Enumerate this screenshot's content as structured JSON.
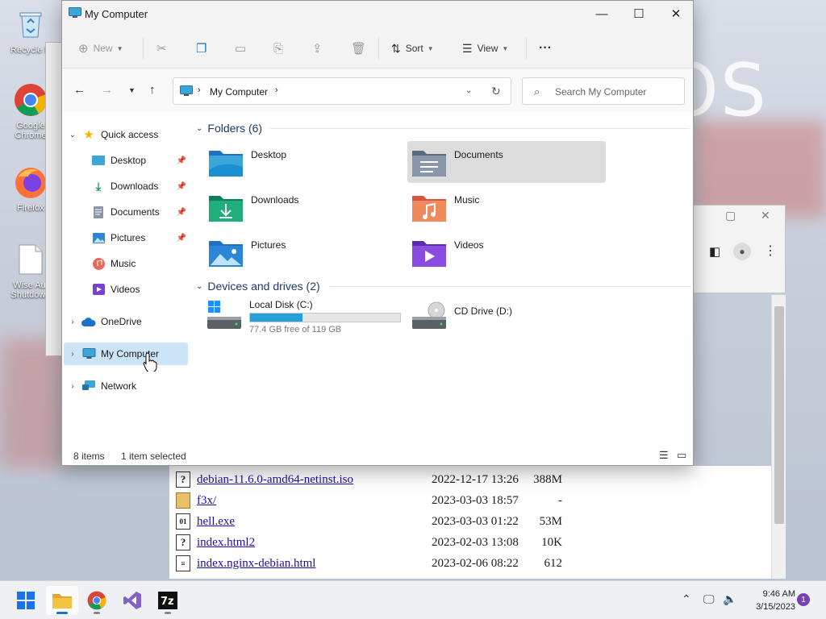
{
  "desktop": {
    "bg_text": "OS",
    "icons": [
      {
        "label": "Recycle Bin",
        "display": "Recycle B"
      },
      {
        "label": "Google Chrome",
        "display": "Google Chrome"
      },
      {
        "label": "Firefox",
        "display": "Firefox"
      },
      {
        "label": "Wise Auto Shutdown",
        "display": "Wise Aut Shutdown"
      }
    ]
  },
  "listing": {
    "rows": [
      {
        "icon": "?",
        "name": "debian-11.6.0-amd64-netinst.iso",
        "date": "2022-12-17 13:26",
        "size": "388M"
      },
      {
        "icon": "folder",
        "name": "f3x/",
        "date": "2023-03-03 18:57",
        "size": "-"
      },
      {
        "icon": "bin",
        "name": "hell.exe",
        "date": "2023-03-03 01:22",
        "size": "53M"
      },
      {
        "icon": "?",
        "name": "index.html2",
        "date": "2023-02-03 13:08",
        "size": "10K"
      },
      {
        "icon": "doc",
        "name": "index.nginx-debian.html",
        "date": "2023-02-06 08:22",
        "size": "612"
      }
    ]
  },
  "explorer": {
    "title": "My Computer",
    "toolbar": {
      "new_label": "New",
      "sort_label": "Sort",
      "view_label": "View",
      "more_label": "···"
    },
    "address": {
      "path": "My Computer",
      "search_placeholder": "Search My Computer"
    },
    "sidebar": {
      "quick_access": "Quick access",
      "pinned": [
        {
          "label": "Desktop",
          "pinned": true
        },
        {
          "label": "Downloads",
          "pinned": true
        },
        {
          "label": "Documents",
          "pinned": true
        },
        {
          "label": "Pictures",
          "pinned": true
        },
        {
          "label": "Music",
          "pinned": false
        },
        {
          "label": "Videos",
          "pinned": false
        }
      ],
      "onedrive": "OneDrive",
      "my_computer": "My Computer",
      "network": "Network"
    },
    "folders_header": "Folders (6)",
    "folders": [
      {
        "label": "Desktop",
        "selected": false
      },
      {
        "label": "Documents",
        "selected": true
      },
      {
        "label": "Downloads",
        "selected": false
      },
      {
        "label": "Music",
        "selected": false
      },
      {
        "label": "Pictures",
        "selected": false
      },
      {
        "label": "Videos",
        "selected": false
      }
    ],
    "devices_header": "Devices and drives (2)",
    "drives": [
      {
        "label": "Local Disk (C:)",
        "free_text": "77.4 GB free of 119 GB",
        "used_fraction": 0.35
      },
      {
        "label": "CD Drive (D:)"
      }
    ],
    "status": {
      "items": "8 items",
      "selected": "1 item selected"
    }
  },
  "taskbar": {
    "time": "9:46 AM",
    "date": "3/15/2023",
    "notification_count": "1"
  },
  "colors": {
    "accent": "#26a0da",
    "selection": "#cce4f7",
    "folder_yellow": "#f5c342",
    "link": "#1a0dab"
  }
}
